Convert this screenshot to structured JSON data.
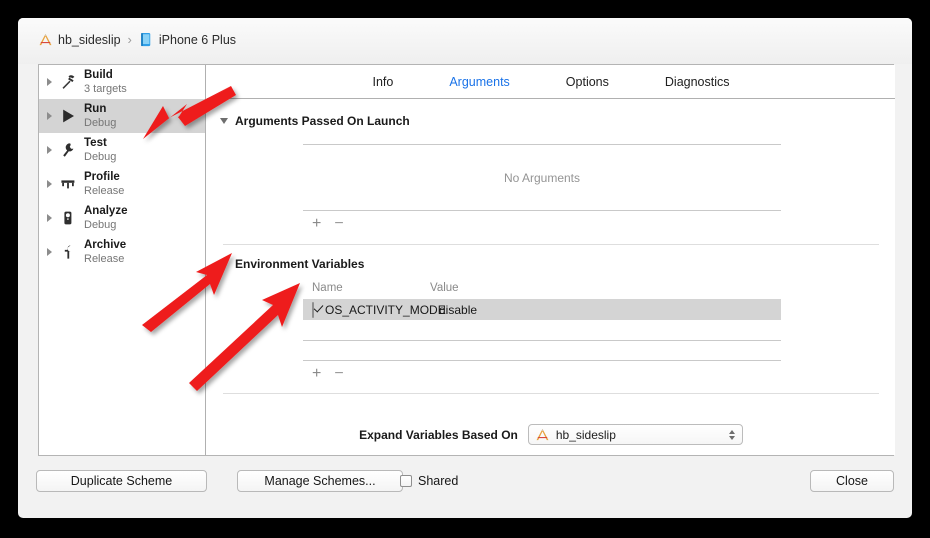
{
  "window": {
    "breadcrumb": {
      "project": "hb_sideslip",
      "separator": "›",
      "device": "iPhone 6 Plus",
      "project_icon": "xcode-project-icon",
      "device_icon": "iphone-device-icon"
    }
  },
  "sidebar": {
    "items": [
      {
        "title": "Build",
        "subtitle": "3 targets",
        "icon": "hammer-icon",
        "selected": false
      },
      {
        "title": "Run",
        "subtitle": "Debug",
        "icon": "play-icon",
        "selected": true
      },
      {
        "title": "Test",
        "subtitle": "Debug",
        "icon": "wrench-icon",
        "selected": false
      },
      {
        "title": "Profile",
        "subtitle": "Release",
        "icon": "gauge-icon",
        "selected": false
      },
      {
        "title": "Analyze",
        "subtitle": "Debug",
        "icon": "magnifier-icon",
        "selected": false
      },
      {
        "title": "Archive",
        "subtitle": "Release",
        "icon": "archive-box-icon",
        "selected": false
      }
    ]
  },
  "tabs": [
    {
      "label": "Info",
      "active": false
    },
    {
      "label": "Arguments",
      "active": true
    },
    {
      "label": "Options",
      "active": false
    },
    {
      "label": "Diagnostics",
      "active": false
    }
  ],
  "arguments_section": {
    "title": "Arguments Passed On Launch",
    "empty_text": "No Arguments",
    "add_label": "+",
    "remove_label": "−"
  },
  "environment_section": {
    "title": "Environment Variables",
    "columns": [
      "Name",
      "Value"
    ],
    "rows": [
      {
        "enabled": true,
        "name": "OS_ACTIVITY_MODE",
        "value": "disable",
        "selected": true
      }
    ],
    "add_label": "+",
    "remove_label": "−"
  },
  "expand_variables": {
    "label": "Expand Variables Based On",
    "value": "hb_sideslip",
    "icon": "xcode-project-icon"
  },
  "bottom_bar": {
    "duplicate_scheme": "Duplicate Scheme",
    "manage_schemes": "Manage Schemes...",
    "shared_label": "Shared",
    "shared_checked": false,
    "close": "Close"
  },
  "annotations": {
    "color": "#ee1c1c",
    "arrow_count": 3
  }
}
